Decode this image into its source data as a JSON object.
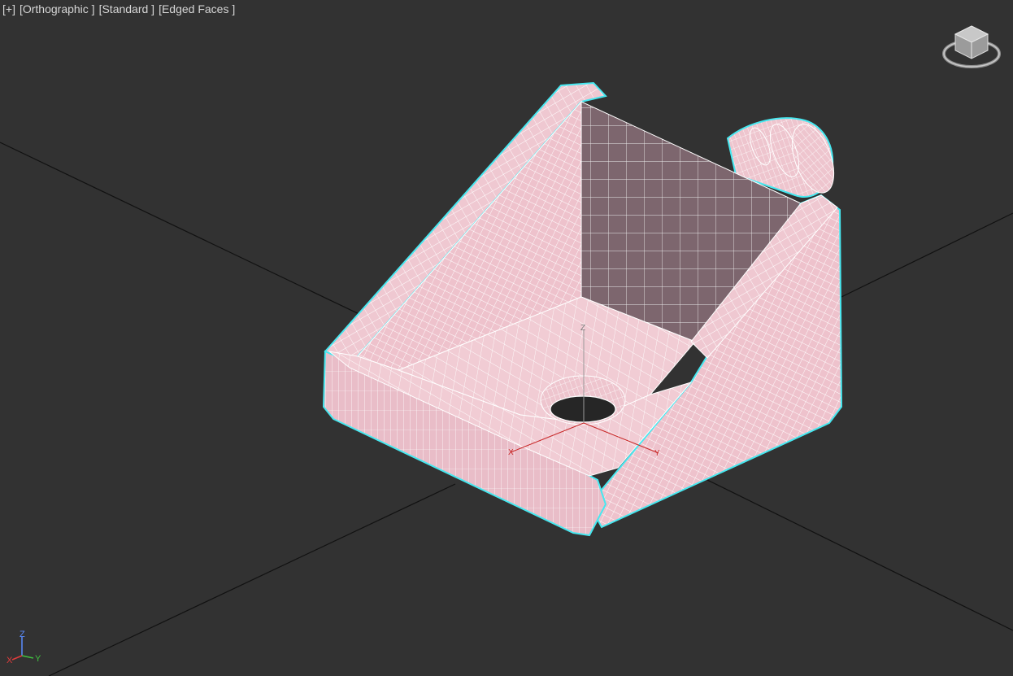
{
  "viewport": {
    "menu": [
      {
        "name": "viewport-general-menu",
        "label": "[+]"
      },
      {
        "name": "viewport-point-of-view-menu",
        "label": "[Orthographic ]"
      },
      {
        "name": "viewport-shading-menu",
        "label": "[Standard ]"
      },
      {
        "name": "viewport-display-mode-menu",
        "label": "[Edged Faces ]"
      }
    ],
    "gizmo_axes": {
      "x": "X",
      "y": "Y",
      "z": "Z"
    },
    "triad_axes": {
      "x": "X",
      "y": "Y",
      "z": "Z"
    }
  },
  "colors": {
    "background": "#323232",
    "grid_line": "#121212",
    "selection": "#46e8f0",
    "mesh_face": "#efc7d0",
    "mesh_shadow": "#7a636c",
    "x_axis": "#e03c3c",
    "y_axis": "#40c040",
    "z_axis": "#5a8cff"
  },
  "icons": {
    "view_cube": "view-cube-icon",
    "axis_triad": "axis-triad-icon"
  }
}
